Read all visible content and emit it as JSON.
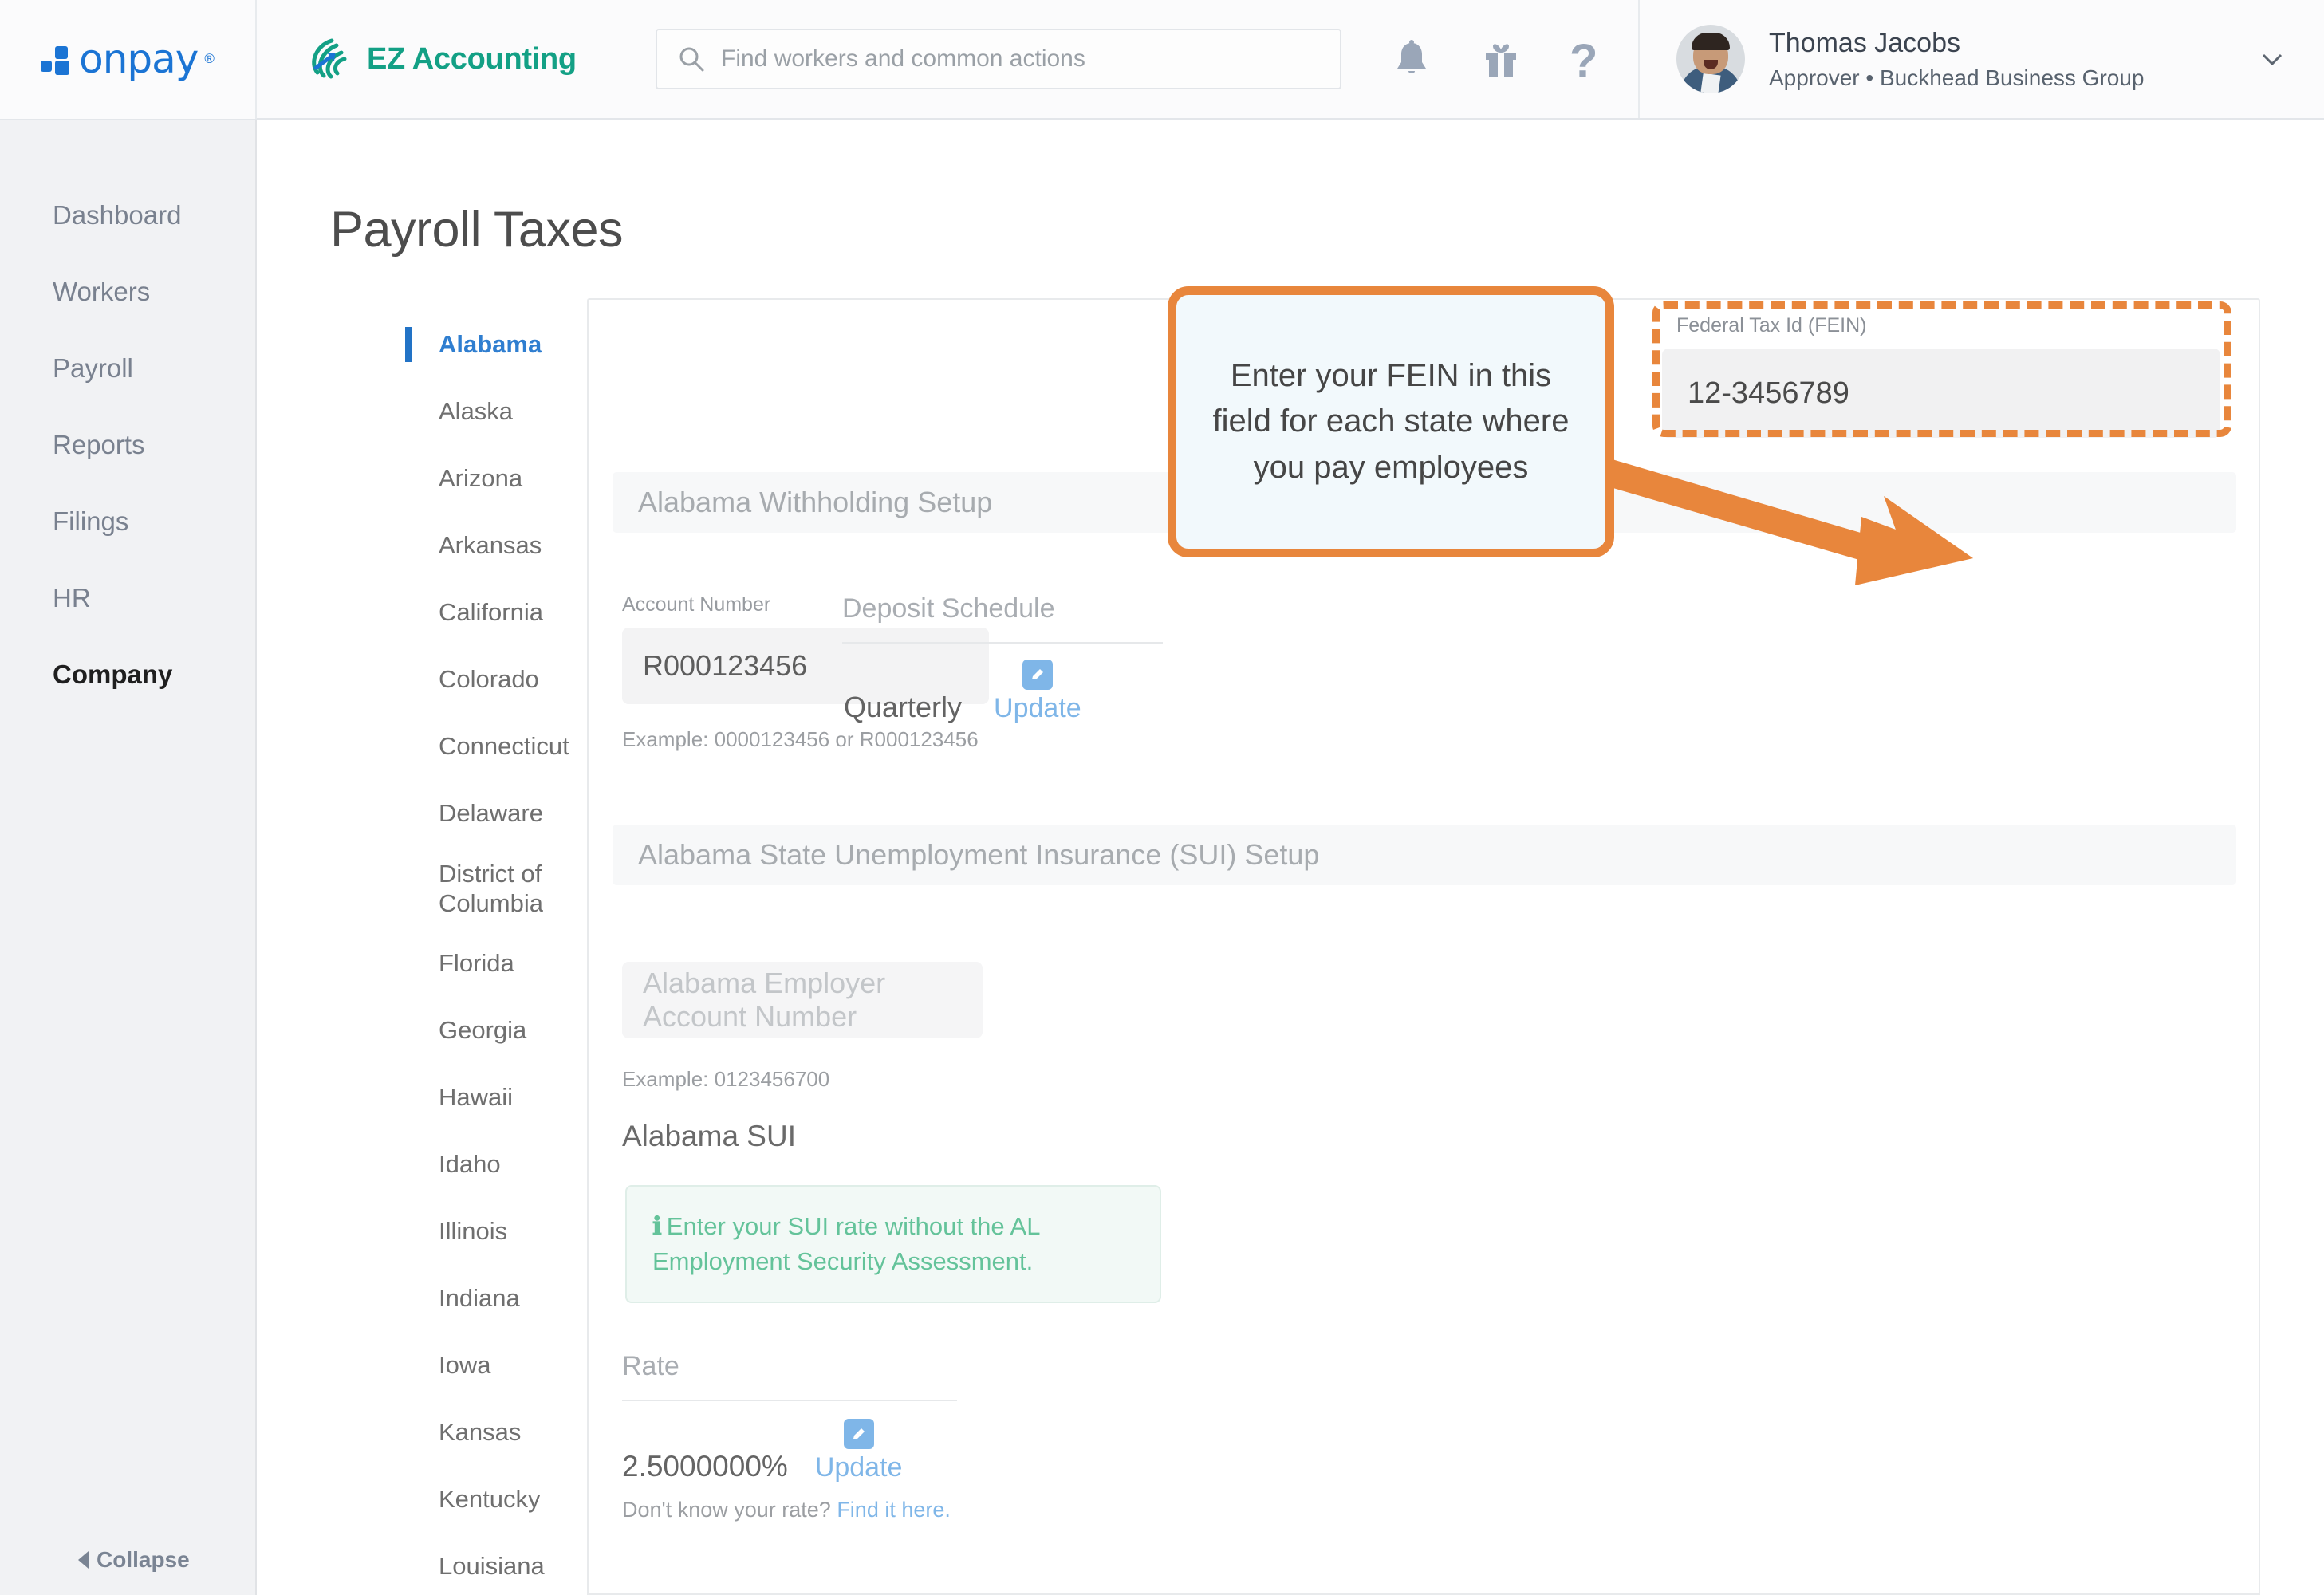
{
  "header": {
    "logo_text": "onpay",
    "logo_reg": "®",
    "partner_name": "EZ Accounting",
    "search_placeholder": "Find workers and common actions",
    "icons": [
      "bell-icon",
      "gift-icon",
      "help-icon"
    ],
    "user": {
      "name": "Thomas Jacobs",
      "role": "Approver • Buckhead Business Group"
    }
  },
  "sidebar": {
    "items": [
      {
        "label": "Dashboard",
        "active": false
      },
      {
        "label": "Workers",
        "active": false
      },
      {
        "label": "Payroll",
        "active": false
      },
      {
        "label": "Reports",
        "active": false
      },
      {
        "label": "Filings",
        "active": false
      },
      {
        "label": "HR",
        "active": false
      },
      {
        "label": "Company",
        "active": true
      }
    ],
    "collapse_label": "Collapse"
  },
  "main": {
    "page_title": "Payroll Taxes",
    "states": [
      {
        "label": "Alabama",
        "active": true
      },
      {
        "label": "Alaska",
        "active": false
      },
      {
        "label": "Arizona",
        "active": false
      },
      {
        "label": "Arkansas",
        "active": false
      },
      {
        "label": "California",
        "active": false
      },
      {
        "label": "Colorado",
        "active": false
      },
      {
        "label": "Connecticut",
        "active": false
      },
      {
        "label": "Delaware",
        "active": false
      },
      {
        "label": "District of Columbia",
        "active": false
      },
      {
        "label": "Florida",
        "active": false
      },
      {
        "label": "Georgia",
        "active": false
      },
      {
        "label": "Hawaii",
        "active": false
      },
      {
        "label": "Idaho",
        "active": false
      },
      {
        "label": "Illinois",
        "active": false
      },
      {
        "label": "Indiana",
        "active": false
      },
      {
        "label": "Iowa",
        "active": false
      },
      {
        "label": "Kansas",
        "active": false
      },
      {
        "label": "Kentucky",
        "active": false
      },
      {
        "label": "Louisiana",
        "active": false
      }
    ],
    "fein": {
      "label": "Federal Tax Id (FEIN)",
      "value": "12-3456789"
    },
    "withholding": {
      "section_title": "Alabama Withholding Setup",
      "account_number_label": "Account Number",
      "account_number_value": "R000123456",
      "example": "Example: 0000123456 or R000123456",
      "deposit_schedule_label": "Deposit Schedule",
      "deposit_schedule_value": "Quarterly",
      "update_label": "Update"
    },
    "sui": {
      "section_title": "Alabama State Unemployment Insurance (SUI) Setup",
      "account_placeholder": "Alabama Employer Account Number",
      "example": "Example: 0123456700",
      "subheading": "Alabama SUI",
      "info_text": "Enter your SUI rate without the AL Employment Security Assessment.",
      "rate_label": "Rate",
      "rate_value": "2.5000000%",
      "update_label": "Update",
      "footer_text": "Don't know your rate?",
      "footer_link": "Find it here."
    }
  },
  "callout": {
    "text": "Enter your FEIN in this field for each state where you pay employees",
    "border_color": "#e8863c",
    "fill_color": "#f2f9fc",
    "arrow_color": "#e8863c"
  },
  "colors": {
    "brand_blue": "#1b74d4",
    "partner_green": "#13a085",
    "accent_orange": "#e8863c",
    "link_blue": "#7fb6e8",
    "active_state_blue": "#2f7ed0",
    "info_green": "#64c39a"
  }
}
